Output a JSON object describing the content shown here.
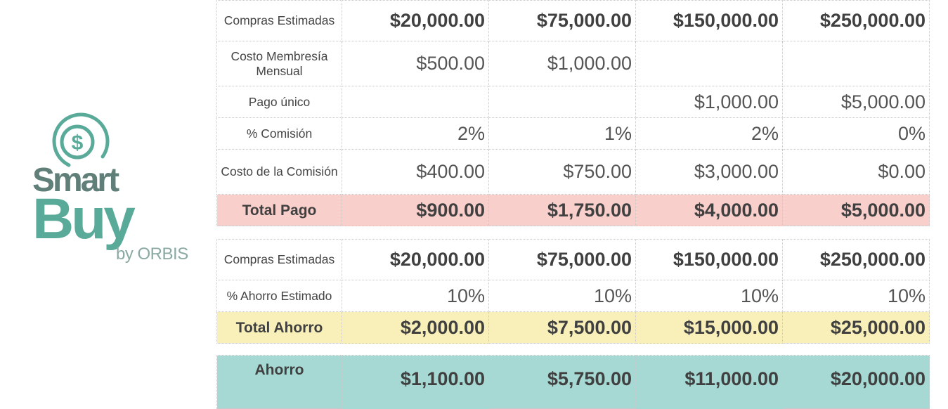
{
  "logo": {
    "icon": "dollar-coin-icon",
    "smart": "Smart",
    "buy": "Buy",
    "by": "by ORBIS",
    "colors": {
      "teal": "#5aaa99",
      "grey": "#5f7f78"
    }
  },
  "table1": {
    "rows": [
      {
        "label": "Compras Estimadas",
        "values": [
          "$20,000.00",
          "$75,000.00",
          "$150,000.00",
          "$250,000.00"
        ]
      },
      {
        "label": "Costo Membresía Mensual",
        "values": [
          "$500.00",
          "$1,000.00",
          "",
          ""
        ]
      },
      {
        "label": "Pago único",
        "values": [
          "",
          "",
          "$1,000.00",
          "$5,000.00"
        ]
      },
      {
        "label": "% Comisión",
        "values": [
          "2%",
          "1%",
          "2%",
          "0%"
        ]
      },
      {
        "label": "Costo de la Comisión",
        "values": [
          "$400.00",
          "$750.00",
          "$3,000.00",
          "$0.00"
        ]
      },
      {
        "label": "Total Pago",
        "values": [
          "$900.00",
          "$1,750.00",
          "$4,000.00",
          "$5,000.00"
        ]
      }
    ]
  },
  "table2": {
    "rows": [
      {
        "label": "Compras Estimadas",
        "values": [
          "$20,000.00",
          "$75,000.00",
          "$150,000.00",
          "$250,000.00"
        ]
      },
      {
        "label": "% Ahorro Estimado",
        "values": [
          "10%",
          "10%",
          "10%",
          "10%"
        ]
      },
      {
        "label": "Total Ahorro",
        "values": [
          "$2,000.00",
          "$7,500.00",
          "$15,000.00",
          "$25,000.00"
        ]
      }
    ]
  },
  "table3": {
    "rows": [
      {
        "label": "Ahorro",
        "values": [
          "$1,100.00",
          "$5,750.00",
          "$11,000.00",
          "$20,000.00"
        ]
      }
    ]
  },
  "colors": {
    "total_pago": "#f9cfcb",
    "total_ahorro": "#f9f0b9",
    "ahorro_neto": "#a6d9d3"
  }
}
